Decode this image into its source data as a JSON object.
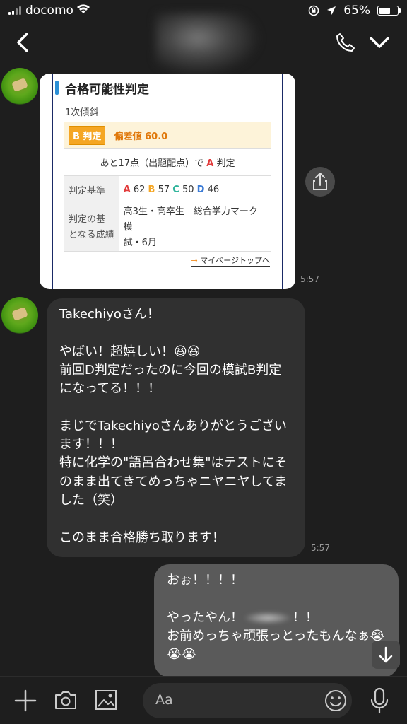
{
  "status_bar": {
    "carrier": "docomo",
    "battery": "65%",
    "battery_level": 0.65
  },
  "card": {
    "title": "合格可能性判定",
    "subtitle": "1次傾斜",
    "badge": "B 判定",
    "hensa": "偏差値 60.0",
    "next_text_prefix": "あと17点（出題配点）で",
    "next_text_grade": "A",
    "next_text_suffix": "判定",
    "criteria_label": "判定基準",
    "criteria": [
      {
        "grade": "A",
        "score": "62"
      },
      {
        "grade": "B",
        "score": "57"
      },
      {
        "grade": "C",
        "score": "50"
      },
      {
        "grade": "D",
        "score": "46"
      }
    ],
    "basis_label_1": "判定の基",
    "basis_label_2": "となる成績",
    "basis_value_1": "高3生・高卒生　総合学力マーク模",
    "basis_value_2": "試・6月",
    "mypage_link": "マイページトップへ"
  },
  "time_card": "5:57",
  "message_left": "Takechiyoさん！\n\nやばい！超嬉しい！😆😆\n前回D判定だったのに今回の模試B判定になってる！！！\n\nまじでTakechiyoさんありがとうございます！！！\n特に化学の\"語呂合わせ集\"はテストにそのまま出てきてめっちゃニヤニヤしてました（笑）\n\nこのまま合格勝ち取ります！",
  "time_left": "5:57",
  "message_right_1": "おぉ！！！！\n\nやったやん！",
  "message_right_2": "！！\nお前めっちゃ頑張っとったもんなぁ😭😭😭",
  "input_placeholder": "Aa"
}
